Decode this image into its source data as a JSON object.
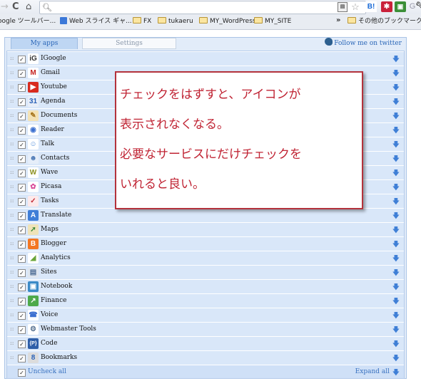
{
  "browser": {
    "omnibox_text": "",
    "bookmarks": [
      {
        "label": "oogle ツールバー...",
        "type": "folder"
      },
      {
        "label": "Web スライス ギャ...",
        "type": "page"
      },
      {
        "label": "FX",
        "type": "folder"
      },
      {
        "label": "tukaeru",
        "type": "folder"
      },
      {
        "label": "MY_WordPress",
        "type": "folder"
      },
      {
        "label": "MY_SITE",
        "type": "folder"
      }
    ],
    "other_bookmarks": "その他のブックマーク",
    "icons": [
      "forward-icon",
      "reload-icon",
      "home-icon",
      "search-icon",
      "page-icon",
      "star-icon",
      "hatena-icon",
      "extension-icon",
      "extension-icon",
      "google-icon",
      "wrench-icon"
    ]
  },
  "popup": {
    "tabs": [
      {
        "label": "My apps",
        "active": true
      },
      {
        "label": "Settings",
        "active": false
      }
    ],
    "twitter_link": "Follow me on twitter",
    "apps": [
      {
        "name": "IGoogle",
        "checked": true,
        "icon": "igoogle-icon",
        "glyph": "iG",
        "color": "#ffffff",
        "fg": "#333333"
      },
      {
        "name": "Gmail",
        "checked": true,
        "icon": "gmail-icon",
        "glyph": "M",
        "color": "#ffffff",
        "fg": "#c5221f"
      },
      {
        "name": "Youtube",
        "checked": true,
        "icon": "youtube-icon",
        "glyph": "▶",
        "color": "#d82a1e",
        "fg": "#ffffff"
      },
      {
        "name": "Agenda",
        "checked": true,
        "icon": "calendar-icon",
        "glyph": "31",
        "color": "#e8eef8",
        "fg": "#2a62b8"
      },
      {
        "name": "Documents",
        "checked": true,
        "icon": "documents-icon",
        "glyph": "✎",
        "color": "#f3e2b5",
        "fg": "#a5731a"
      },
      {
        "name": "Reader",
        "checked": true,
        "icon": "reader-icon",
        "glyph": "◉",
        "color": "#ffffff",
        "fg": "#3b6fd0"
      },
      {
        "name": "Talk",
        "checked": true,
        "icon": "talk-icon",
        "glyph": "☺",
        "color": "#ffffff",
        "fg": "#4f8cd9"
      },
      {
        "name": "Contacts",
        "checked": true,
        "icon": "contacts-icon",
        "glyph": "☻",
        "color": "#e6eef9",
        "fg": "#4b78b5"
      },
      {
        "name": "Wave",
        "checked": true,
        "icon": "wave-icon",
        "glyph": "W",
        "color": "#ffffff",
        "fg": "#8a8f1e"
      },
      {
        "name": "Picasa",
        "checked": true,
        "icon": "picasa-icon",
        "glyph": "✿",
        "color": "#ffffff",
        "fg": "#d84b9a"
      },
      {
        "name": "Tasks",
        "checked": true,
        "icon": "tasks-icon",
        "glyph": "✓",
        "color": "#fde9ea",
        "fg": "#c22b36"
      },
      {
        "name": "Translate",
        "checked": true,
        "icon": "translate-icon",
        "glyph": "A",
        "color": "#3f7ed7",
        "fg": "#ffffff"
      },
      {
        "name": "Maps",
        "checked": true,
        "icon": "maps-icon",
        "glyph": "➚",
        "color": "#efe3b8",
        "fg": "#3c8a3a"
      },
      {
        "name": "Blogger",
        "checked": true,
        "icon": "blogger-icon",
        "glyph": "B",
        "color": "#f37723",
        "fg": "#ffffff"
      },
      {
        "name": "Analytics",
        "checked": true,
        "icon": "analytics-icon",
        "glyph": "◢",
        "color": "#ffffff",
        "fg": "#6aa53a"
      },
      {
        "name": "Sites",
        "checked": true,
        "icon": "sites-icon",
        "glyph": "▤",
        "color": "#dfe6ef",
        "fg": "#4f6e96"
      },
      {
        "name": "Notebook",
        "checked": true,
        "icon": "notebook-icon",
        "glyph": "▣",
        "color": "#3a8ac7",
        "fg": "#ffffff"
      },
      {
        "name": "Finance",
        "checked": true,
        "icon": "finance-icon",
        "glyph": "↗",
        "color": "#4da94a",
        "fg": "#ffffff"
      },
      {
        "name": "Voice",
        "checked": true,
        "icon": "voice-icon",
        "glyph": "☎",
        "color": "#ffffff",
        "fg": "#3b6fd0"
      },
      {
        "name": "Webmaster Tools",
        "checked": true,
        "icon": "webmaster-tools-icon",
        "glyph": "⚙",
        "color": "#ffffff",
        "fg": "#557090"
      },
      {
        "name": "Code",
        "checked": true,
        "icon": "code-icon",
        "glyph": "{P}",
        "color": "#2e5ea8",
        "fg": "#ffffff"
      },
      {
        "name": "Bookmarks",
        "checked": true,
        "icon": "bookmarks-icon",
        "glyph": "8",
        "color": "#dcdcdc",
        "fg": "#2a62b8"
      }
    ],
    "uncheck_all": "Uncheck all",
    "expand_all": "Expand all"
  },
  "callout": {
    "lines": [
      "チェックをはずすと、アイコンが",
      "表示されなくなる。",
      "必要なサービスにだけチェックを",
      "いれると良い。"
    ]
  }
}
